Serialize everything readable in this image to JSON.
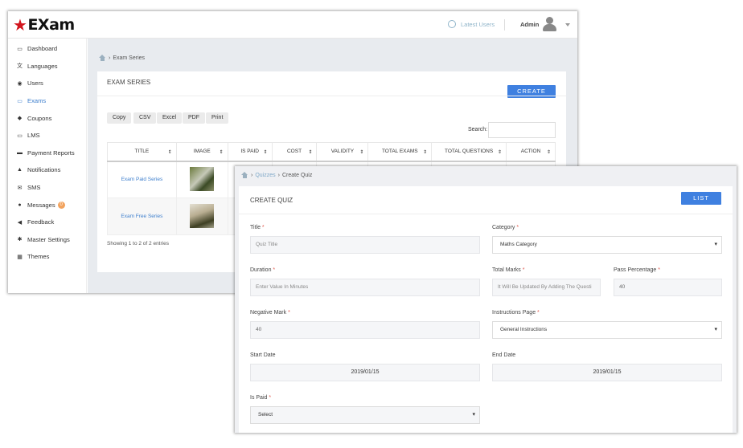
{
  "w1": {
    "logo": "EXam",
    "topbar": {
      "latest_users": "Latest Users",
      "admin": "Admin"
    },
    "sidebar": {
      "items": [
        {
          "label": "Dashboard",
          "icon": "dashboard-icon"
        },
        {
          "label": "Languages",
          "icon": "languages-icon"
        },
        {
          "label": "Users",
          "icon": "users-icon"
        },
        {
          "label": "Exams",
          "icon": "monitor-icon",
          "active": true
        },
        {
          "label": "Coupons",
          "icon": "tag-icon"
        },
        {
          "label": "LMS",
          "icon": "monitor-icon"
        },
        {
          "label": "Payment Reports",
          "icon": "credit-card-icon"
        },
        {
          "label": "Notifications",
          "icon": "bell-icon"
        },
        {
          "label": "SMS",
          "icon": "envelope-icon"
        },
        {
          "label": "Messages",
          "icon": "comments-icon",
          "badge": "0"
        },
        {
          "label": "Feedback",
          "icon": "megaphone-icon"
        },
        {
          "label": "Master Settings",
          "icon": "gear-icon"
        },
        {
          "label": "Themes",
          "icon": "grid-icon"
        }
      ]
    },
    "breadcrumb": {
      "current": "Exam Series"
    },
    "card": {
      "title": "EXAM SERIES",
      "create": "CREATE",
      "export": [
        "Copy",
        "CSV",
        "Excel",
        "PDF",
        "Print"
      ],
      "search_label": "Search:",
      "columns": [
        "TITLE",
        "IMAGE",
        "IS PAID",
        "COST",
        "VALIDITY",
        "TOTAL EXAMS",
        "TOTAL QUESTIONS",
        "ACTION"
      ],
      "rows": [
        {
          "title": "Exam Paid Series"
        },
        {
          "title": "Exam Free Series"
        }
      ],
      "showing": "Showing 1 to 2 of 2 entries"
    }
  },
  "w2": {
    "breadcrumb": {
      "parent": "Quizzes",
      "current": "Create Quiz"
    },
    "card": {
      "title": "CREATE QUIZ",
      "list": "LIST",
      "fields": {
        "title": {
          "label": "Title",
          "placeholder": "Quiz Title"
        },
        "category": {
          "label": "Category",
          "value": "Maths Category"
        },
        "duration": {
          "label": "Duration",
          "placeholder": "Enter Value In Minutes"
        },
        "total_marks": {
          "label": "Total Marks",
          "placeholder": "It Will Be Updated By Adding The Questi"
        },
        "pass_percentage": {
          "label": "Pass Percentage",
          "value": "40"
        },
        "negative_mark": {
          "label": "Negative Mark",
          "value": "40"
        },
        "instructions_page": {
          "label": "Instructions Page",
          "value": "General Instructions"
        },
        "start_date": {
          "label": "Start Date",
          "value": "2019/01/15"
        },
        "end_date": {
          "label": "End Date",
          "value": "2019/01/15"
        },
        "is_paid": {
          "label": "Is Paid",
          "value": "Select"
        }
      },
      "required_mark": "*"
    }
  },
  "colors": {
    "accent": "#3f80e0",
    "link": "#3e7fcd",
    "logo_star": "#d2161e",
    "required": "#e05a4f"
  }
}
